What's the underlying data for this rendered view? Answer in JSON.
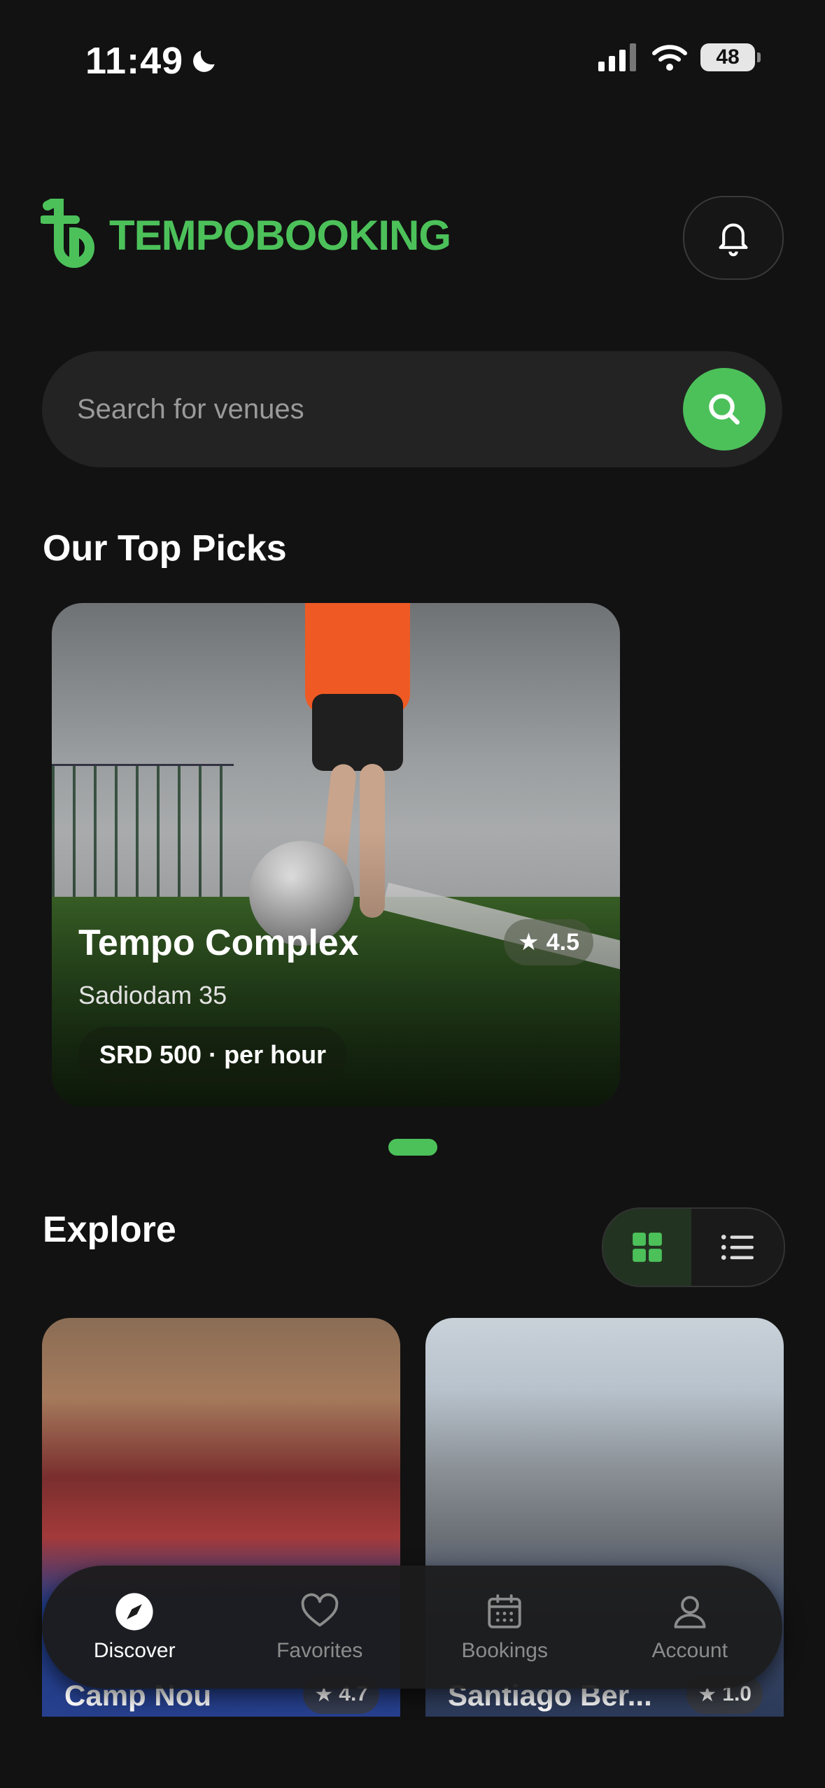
{
  "status": {
    "time": "11:49",
    "battery": "48"
  },
  "header": {
    "logo_text": "TEMPOBOOKING"
  },
  "search": {
    "placeholder": "Search for venues"
  },
  "top_picks": {
    "title": "Our Top Picks",
    "cards": [
      {
        "name": "Tempo Complex",
        "rating": "4.5",
        "address": "Sadiodam 35",
        "price": "SRD 500 · per hour"
      }
    ]
  },
  "explore": {
    "title": "Explore",
    "cards": [
      {
        "name": "Camp Nou",
        "rating": "4.7"
      },
      {
        "name": "Santiago Ber...",
        "rating": "1.0"
      }
    ]
  },
  "nav": {
    "items": [
      {
        "label": "Discover",
        "icon": "compass-icon",
        "active": true
      },
      {
        "label": "Favorites",
        "icon": "heart-icon",
        "active": false
      },
      {
        "label": "Bookings",
        "icon": "calendar-icon",
        "active": false
      },
      {
        "label": "Account",
        "icon": "user-icon",
        "active": false
      }
    ]
  },
  "colors": {
    "accent": "#4cc15a",
    "background": "#121212"
  }
}
